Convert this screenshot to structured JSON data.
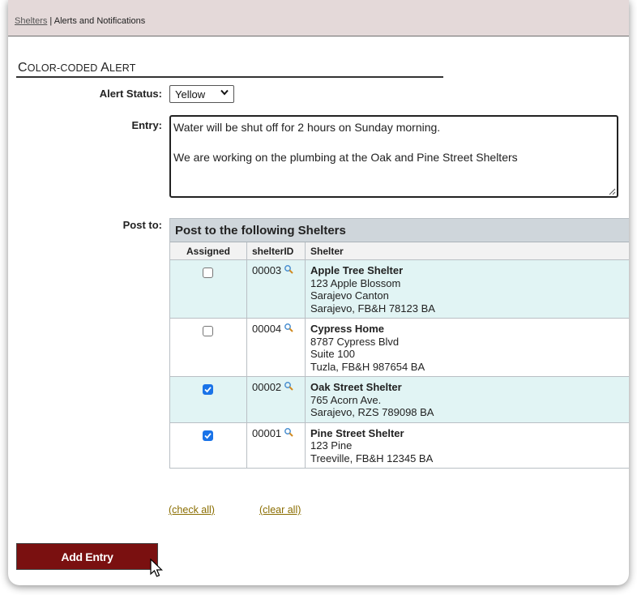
{
  "breadcrumb": {
    "link": "Shelters",
    "separator": " | ",
    "current": "Alerts and Notifications"
  },
  "section": {
    "title_first": "C",
    "title_rest1": "OLOR-CODED ",
    "title_first2": "A",
    "title_rest2": "LERT"
  },
  "form": {
    "alert_status_label": "Alert Status:",
    "alert_status_value": "Yellow",
    "entry_label": "Entry:",
    "entry_lines": [
      "Water will be shut off for 2 hours on Sunday morning.",
      "We are working on the plumbing at the Oak and Pine Street Shelters"
    ],
    "post_to_label": "Post to:"
  },
  "table": {
    "title": "Post to the following Shelters",
    "columns": [
      "Assigned",
      "shelterID",
      "Shelter"
    ],
    "rows": [
      {
        "assigned": false,
        "id": "00003",
        "name": "Apple Tree Shelter",
        "address": [
          "123 Apple Blossom",
          "Sarajevo Canton",
          "Sarajevo, FB&H 78123 BA"
        ]
      },
      {
        "assigned": false,
        "id": "00004",
        "name": "Cypress Home",
        "address": [
          "8787 Cypress Blvd",
          "Suite 100",
          "Tuzla, FB&H 987654 BA"
        ]
      },
      {
        "assigned": true,
        "id": "00002",
        "name": "Oak Street Shelter",
        "address": [
          "765 Acorn Ave.",
          "Sarajevo, RZS 789098 BA"
        ]
      },
      {
        "assigned": true,
        "id": "00001",
        "name": "Pine Street Shelter",
        "address": [
          "123 Pine",
          "Treeville, FB&H 12345 BA"
        ]
      }
    ]
  },
  "links": {
    "check_all": "(check all)",
    "clear_all": "(clear all)"
  },
  "button": {
    "add_entry": "Add Entry"
  },
  "colors": {
    "button_bg": "#7a1010",
    "alt_row": "#e1f4f4",
    "header_bg": "#cfd6db",
    "topbar_bg": "#e4d9d9",
    "checkbox_on": "#1a73e8"
  },
  "icons": {
    "lookup": "magnifier-icon",
    "select": "chevron-down-icon",
    "cursor": "mouse-pointer-icon"
  }
}
